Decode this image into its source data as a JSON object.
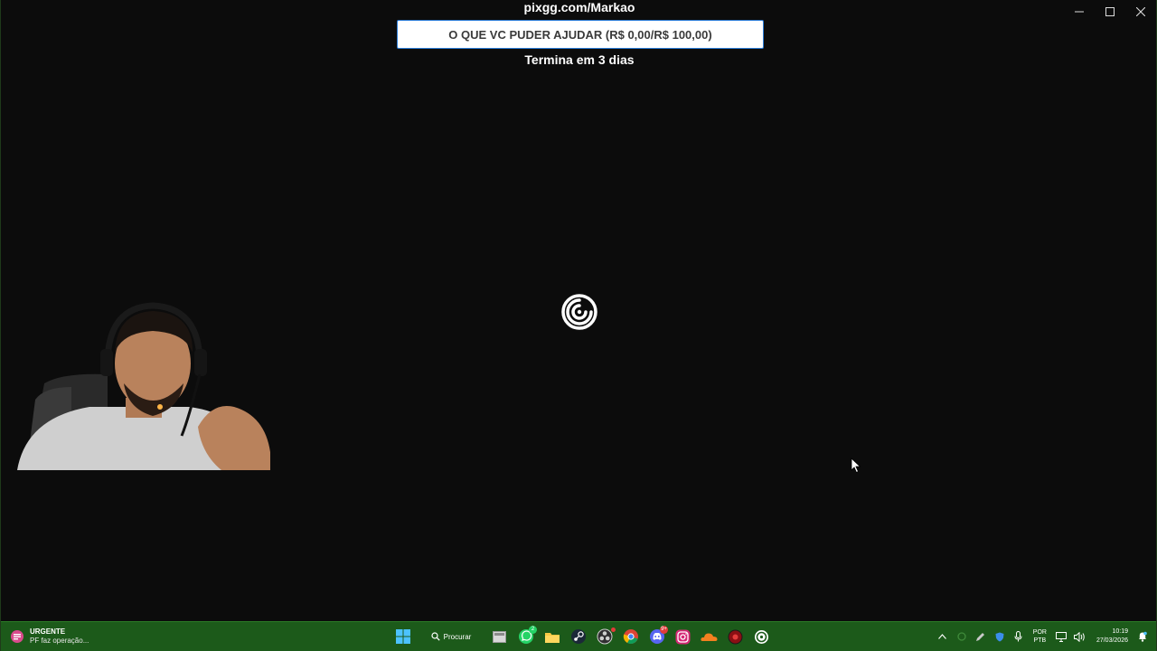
{
  "overlay": {
    "pix_url": "pixgg.com/Markao",
    "goal_text": "O QUE VC PUDER AJUDAR (R$ 0,00/R$ 100,00)",
    "goal_progress": 0,
    "goal_subtitle": "Termina em 3 dias"
  },
  "window_controls": [
    "minimize-icon",
    "maximize-icon",
    "close-icon"
  ],
  "loader": {
    "icon": "ubisoft-swirl-icon",
    "color": "#ffffff"
  },
  "taskbar": {
    "color": "#1c5a1a",
    "news": {
      "icon": "news-widget-icon",
      "title": "URGENTE",
      "subtitle": "PF faz operação..."
    },
    "search_label": "Procurar",
    "apps": [
      {
        "icon": "windows-start-icon"
      },
      {
        "icon": "task-view-icon"
      },
      {
        "icon": "whatsapp-icon",
        "badge": "2"
      },
      {
        "icon": "file-explorer-icon"
      },
      {
        "icon": "steam-icon"
      },
      {
        "icon": "obs-icon"
      },
      {
        "icon": "chrome-icon"
      },
      {
        "icon": "discord-icon",
        "badge": "9+"
      },
      {
        "icon": "instagram-icon"
      },
      {
        "icon": "cloud-app-icon"
      },
      {
        "icon": "red-app-icon"
      },
      {
        "icon": "ubisoft-connect-icon"
      }
    ],
    "tray": {
      "language_top": "POR",
      "language_bottom": "PTB",
      "time": "10:19",
      "date": "27/03/2026"
    }
  }
}
